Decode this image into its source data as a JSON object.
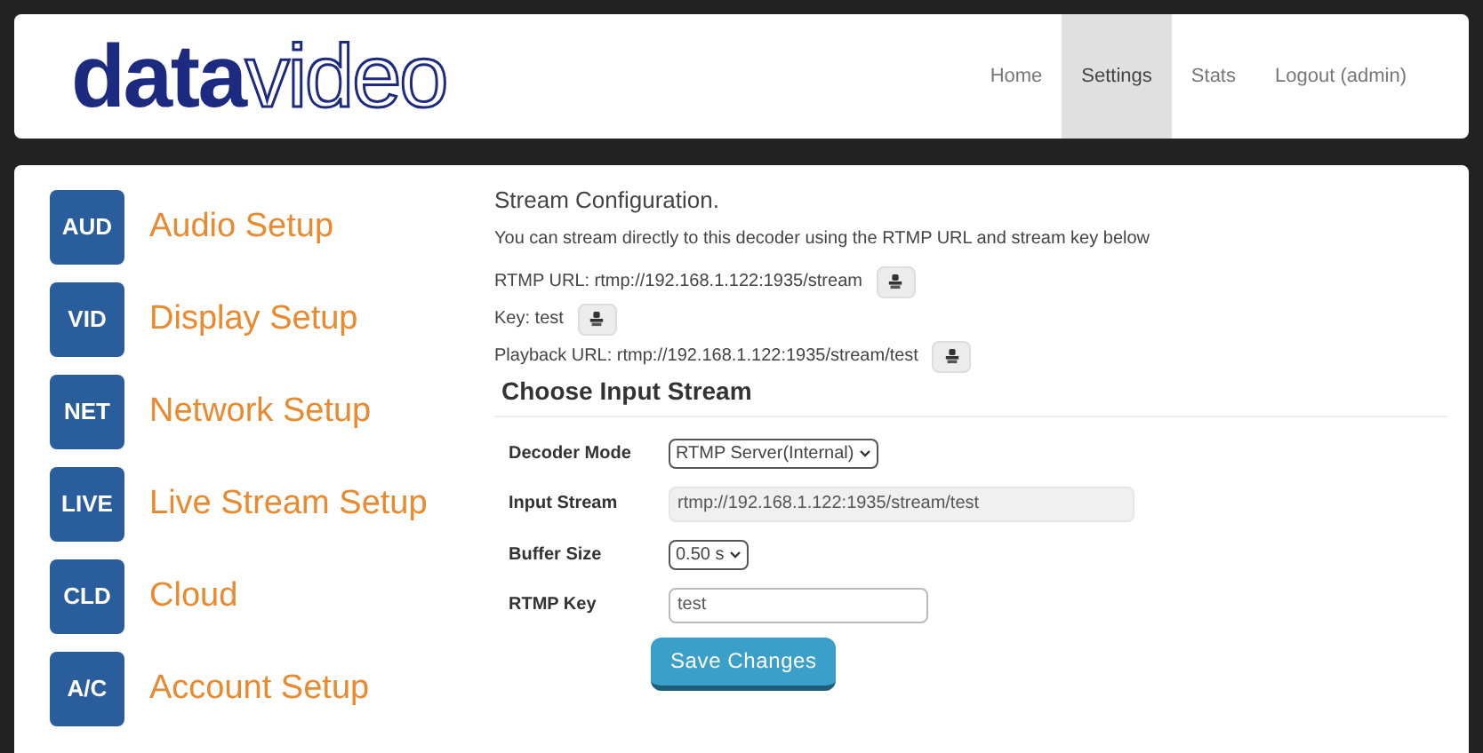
{
  "logo": {
    "bold": "data",
    "outline": "video"
  },
  "nav": [
    {
      "label": "Home",
      "selected": false
    },
    {
      "label": "Settings",
      "selected": true
    },
    {
      "label": "Stats",
      "selected": false
    },
    {
      "label": "Logout (admin)",
      "selected": false
    }
  ],
  "sidebar": {
    "items": [
      {
        "badge": "AUD",
        "label": "Audio Setup"
      },
      {
        "badge": "VID",
        "label": "Display Setup"
      },
      {
        "badge": "NET",
        "label": "Network Setup"
      },
      {
        "badge": "LIVE",
        "label": "Live Stream Setup"
      },
      {
        "badge": "CLD",
        "label": "Cloud"
      },
      {
        "badge": "A/C",
        "label": "Account Setup"
      }
    ]
  },
  "stream_config": {
    "title": "Stream Configuration.",
    "description": "You can stream directly to this decoder using the RTMP URL and stream key below",
    "lines": [
      {
        "text": "RTMP URL: rtmp://192.168.1.122:1935/stream"
      },
      {
        "text": "Key: test"
      },
      {
        "text": "Playback URL: rtmp://192.168.1.122:1935/stream/test"
      }
    ]
  },
  "input_stream": {
    "heading": "Choose Input Stream",
    "fields": [
      {
        "kind": "select",
        "label": "Decoder Mode",
        "value": "RTMP Server(Internal)"
      },
      {
        "kind": "readonly",
        "label": "Input Stream",
        "value": "rtmp://192.168.1.122:1935/stream/test"
      },
      {
        "kind": "select",
        "label": "Buffer Size",
        "value": "0.50 s"
      },
      {
        "kind": "text",
        "label": "RTMP Key",
        "value": "test"
      }
    ],
    "save_button": "Save Changes"
  }
}
